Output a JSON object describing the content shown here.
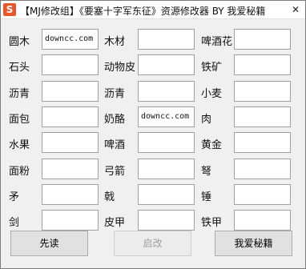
{
  "window": {
    "icon_glyph": "S",
    "title": "【MJ修改组】《要塞十字军东征》资源修改器 BY 我爱秘籍",
    "close_glyph": "✕"
  },
  "grid": [
    [
      {
        "label": "圆木",
        "value": "downcc.com"
      },
      {
        "label": "木材",
        "value": ""
      },
      {
        "label": "啤酒花",
        "value": ""
      }
    ],
    [
      {
        "label": "石头",
        "value": ""
      },
      {
        "label": "动物皮",
        "value": ""
      },
      {
        "label": "铁矿",
        "value": ""
      }
    ],
    [
      {
        "label": "沥青",
        "value": ""
      },
      {
        "label": "沥青",
        "value": ""
      },
      {
        "label": "小麦",
        "value": ""
      }
    ],
    [
      {
        "label": "面包",
        "value": ""
      },
      {
        "label": "奶酪",
        "value": "downcc.com"
      },
      {
        "label": "肉",
        "value": ""
      }
    ],
    [
      {
        "label": "水果",
        "value": ""
      },
      {
        "label": "啤酒",
        "value": ""
      },
      {
        "label": "黄金",
        "value": ""
      }
    ],
    [
      {
        "label": "面粉",
        "value": ""
      },
      {
        "label": "弓箭",
        "value": ""
      },
      {
        "label": "弩",
        "value": ""
      }
    ],
    [
      {
        "label": "矛",
        "value": ""
      },
      {
        "label": "戟",
        "value": ""
      },
      {
        "label": "锤",
        "value": ""
      }
    ],
    [
      {
        "label": "剑",
        "value": ""
      },
      {
        "label": "皮甲",
        "value": ""
      },
      {
        "label": "铁甲",
        "value": ""
      }
    ]
  ],
  "buttons": {
    "read": "先读",
    "apply": "启改",
    "about": "我爱秘籍"
  }
}
